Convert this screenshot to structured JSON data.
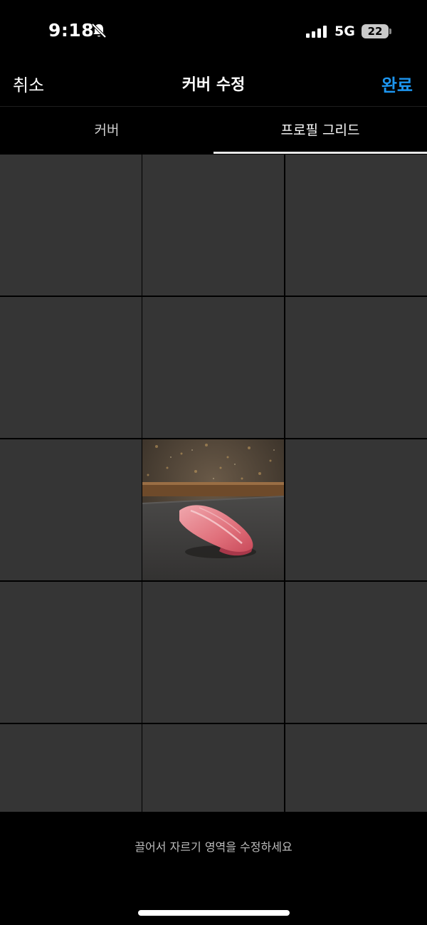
{
  "status_bar": {
    "time": "9:18",
    "network": "5G",
    "battery": "22"
  },
  "nav": {
    "cancel_label": "취소",
    "title": "커버 수정",
    "done_label": "완료",
    "done_color": "#1d96f0"
  },
  "tabs": [
    {
      "label": "커버",
      "selected": false
    },
    {
      "label": "프로필 그리드",
      "selected": true
    }
  ],
  "grid": {
    "rows": 5,
    "columns": 3,
    "photo_cell": {
      "row": 3,
      "column": 2
    },
    "photo_icon": "tuna-nigiri-photo"
  },
  "hint": "끌어서 자르기 영역을 수정하세요"
}
